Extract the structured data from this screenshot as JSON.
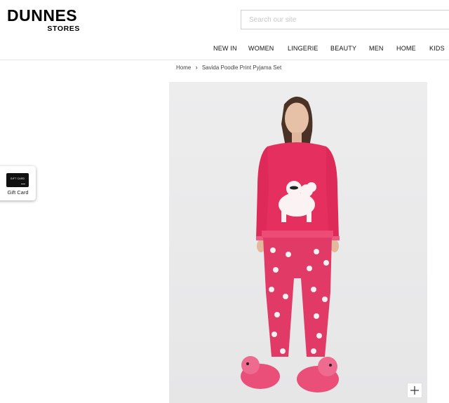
{
  "brand": {
    "name": "DUNNES",
    "sub": "STORES"
  },
  "search": {
    "placeholder": "Search our site",
    "value": ""
  },
  "nav": {
    "items": [
      {
        "label": "NEW IN"
      },
      {
        "label": "WOMEN"
      },
      {
        "label": "LINGERIE"
      },
      {
        "label": "BEAUTY"
      },
      {
        "label": "MEN"
      },
      {
        "label": "HOME"
      },
      {
        "label": "KIDS"
      }
    ]
  },
  "breadcrumb": {
    "home": "Home",
    "current": "Savida Poodle Print Pyjama Set"
  },
  "gift_card": {
    "label": "Gift Card",
    "card_text": "GIFT CARD"
  },
  "product": {
    "image_icon": "product-photo",
    "zoom_icon": "plus-icon"
  },
  "colors": {
    "pyjama_pink": "#e5305f",
    "background": "#ececed",
    "text": "#111111"
  }
}
